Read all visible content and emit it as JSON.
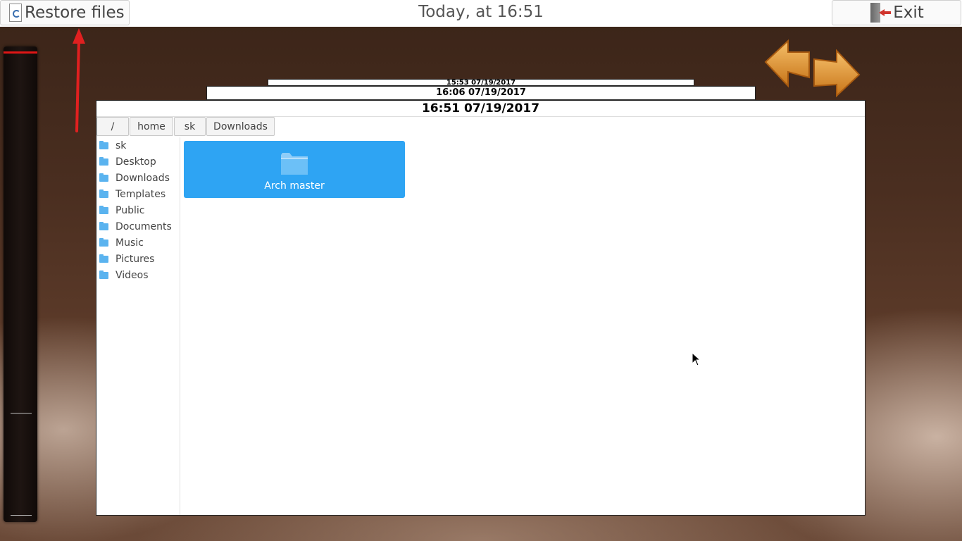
{
  "topbar": {
    "restore_label": "Restore files",
    "title": "Today, at 16:51",
    "exit_label": "Exit"
  },
  "snapshots": {
    "older2": "15:53 07/19/2017",
    "older1": "16:06 07/19/2017",
    "current": "16:51 07/19/2017"
  },
  "breadcrumb": [
    "/",
    "home",
    "sk",
    "Downloads"
  ],
  "sidebar": {
    "items": [
      {
        "label": "sk",
        "icon": "home-folder-icon"
      },
      {
        "label": "Desktop",
        "icon": "desktop-folder-icon"
      },
      {
        "label": "Downloads",
        "icon": "downloads-folder-icon"
      },
      {
        "label": "Templates",
        "icon": "templates-folder-icon"
      },
      {
        "label": "Public",
        "icon": "public-folder-icon"
      },
      {
        "label": "Documents",
        "icon": "documents-folder-icon"
      },
      {
        "label": "Music",
        "icon": "music-folder-icon"
      },
      {
        "label": "Pictures",
        "icon": "pictures-folder-icon"
      },
      {
        "label": "Videos",
        "icon": "videos-folder-icon"
      }
    ]
  },
  "files": [
    {
      "name": "Arch master",
      "icon": "folder-icon",
      "selected": true
    }
  ],
  "colors": {
    "accent": "#2ea4f3",
    "timeline_marker": "#e01616",
    "annotation": "#e02020",
    "nav_arrow": "#e8a040"
  }
}
